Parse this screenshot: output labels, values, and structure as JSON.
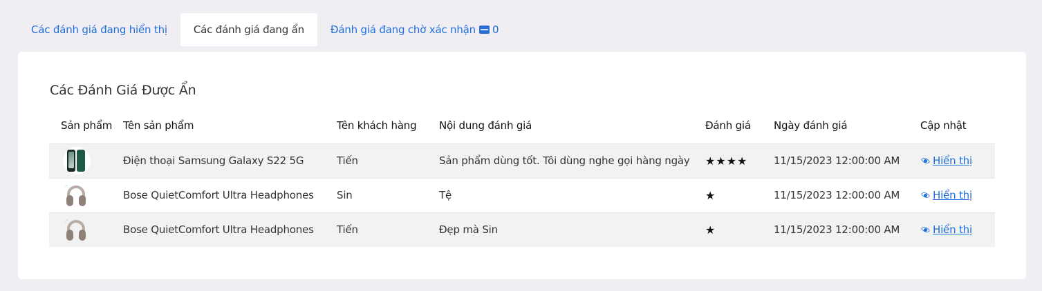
{
  "tabs": [
    {
      "label": "Các đánh giá đang hiển thị",
      "active": false
    },
    {
      "label": "Các đánh giá đang ẩn",
      "active": true
    },
    {
      "label": "Đánh giá đang chờ xác nhận",
      "active": false,
      "count": "0",
      "icon": "new-badge-icon"
    }
  ],
  "card": {
    "title": "Các Đánh Giá Được Ẩn"
  },
  "table": {
    "headers": [
      "Sản phẩm",
      "Tên sản phẩm",
      "Tên khách hàng",
      "Nội dung đánh giá",
      "Đánh giá",
      "Ngày đánh giá",
      "Cập nhật"
    ],
    "rows": [
      {
        "image": "samsung-phone-image",
        "product": "Điện thoại Samsung Galaxy S22 5G",
        "customer": "Tiến",
        "content": "Sản phẩm dùng tốt. Tôi dùng nghe gọi hàng ngày",
        "rating": "★★★★",
        "date": "11/15/2023 12:00:00 AM",
        "action": "Hiển thị"
      },
      {
        "image": "bose-headphones-image",
        "product": "Bose QuietComfort Ultra Headphones",
        "customer": "Sin",
        "content": "Tệ",
        "rating": "★",
        "date": "11/15/2023 12:00:00 AM",
        "action": "Hiển thị"
      },
      {
        "image": "bose-headphones-image",
        "product": "Bose QuietComfort Ultra Headphones",
        "customer": "Tiến",
        "content": "Đẹp mà Sin",
        "rating": "★",
        "date": "11/15/2023 12:00:00 AM",
        "action": "Hiển thị"
      }
    ]
  },
  "colors": {
    "accent": "#1e6fd9",
    "page_bg": "#f1eef3",
    "row_stripe": "#f2f2f2"
  }
}
